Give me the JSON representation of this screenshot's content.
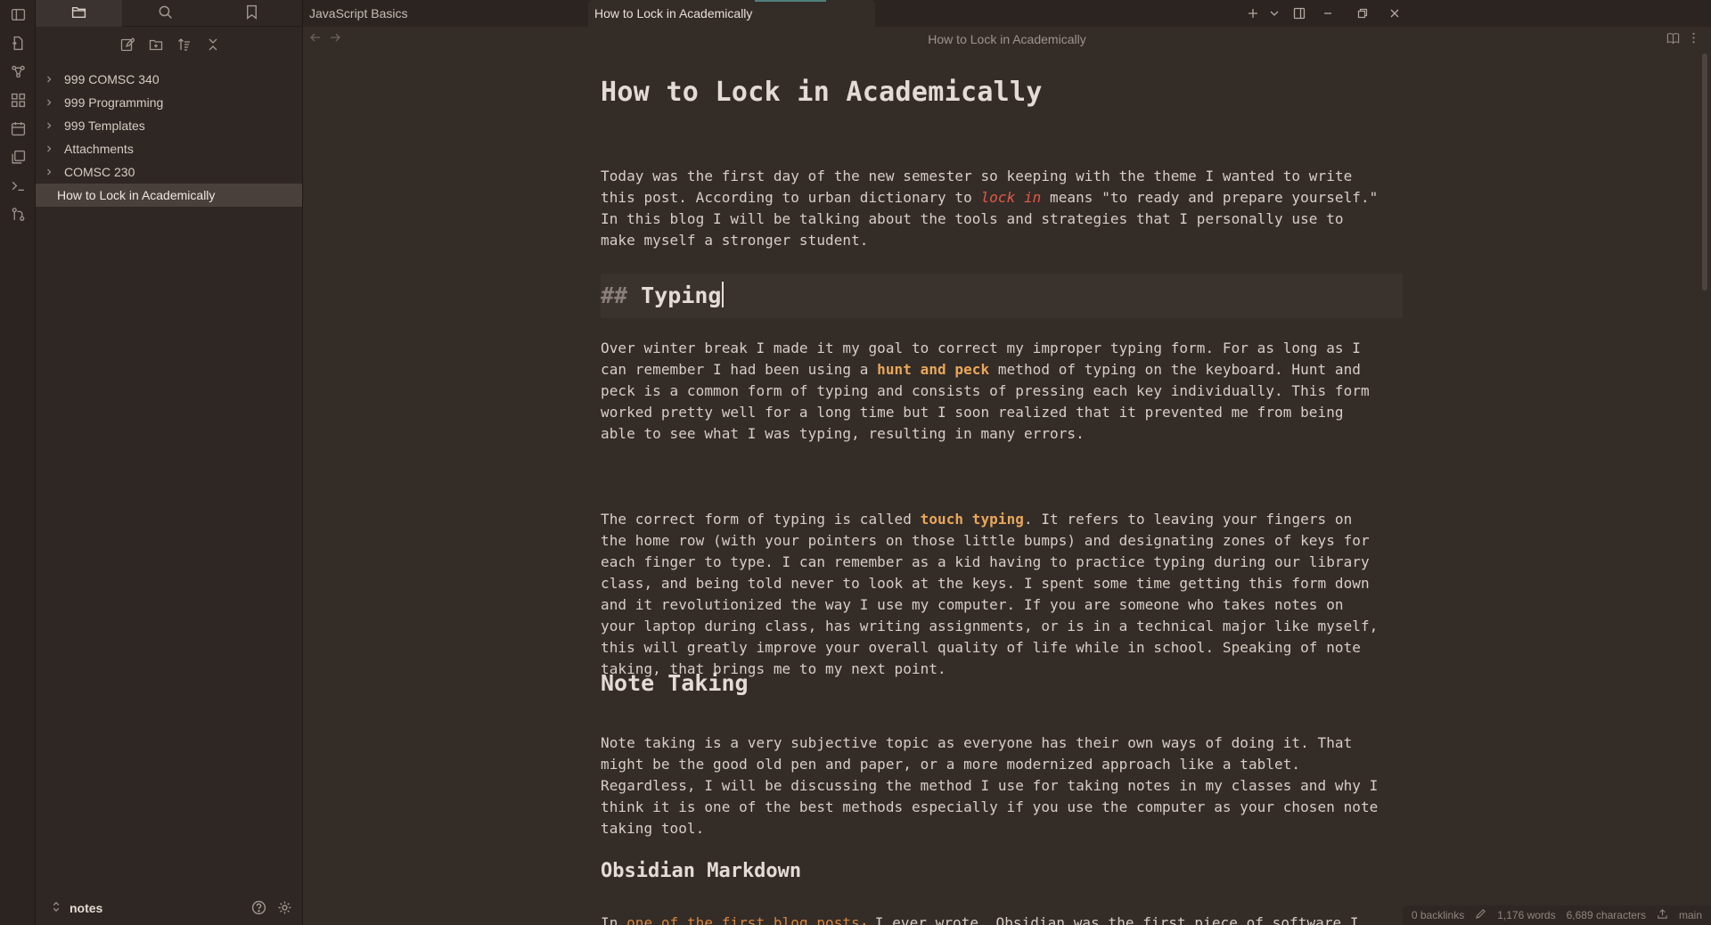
{
  "ribbon": {
    "icons": [
      "sidebar-toggle-icon",
      "open-quick-switcher-icon",
      "graph-view-icon",
      "canvas-icon",
      "daily-note-icon",
      "templates-icon",
      "terminal-icon",
      "git-icon"
    ]
  },
  "sidebar": {
    "tabs": [
      "files",
      "search",
      "bookmarks"
    ],
    "tree": [
      {
        "label": "999 COMSC 340",
        "type": "folder"
      },
      {
        "label": "999 Programming",
        "type": "folder"
      },
      {
        "label": "999 Templates",
        "type": "folder"
      },
      {
        "label": "Attachments",
        "type": "folder"
      },
      {
        "label": "COMSC 230",
        "type": "folder"
      },
      {
        "label": "How to Lock in Academically",
        "type": "file",
        "selected": true
      }
    ],
    "vault_name": "notes"
  },
  "tabs": [
    {
      "label": "JavaScript Basics",
      "active": false
    },
    {
      "label": "How to Lock in Academically",
      "active": true
    }
  ],
  "view": {
    "title": "How to Lock in Academically"
  },
  "document": {
    "title": "How to Lock in Academically",
    "p1_a": "Today was the first day of the new semester so keeping with the theme I wanted to write\nthis post. According to urban dictionary to ",
    "p1_em": "lock in",
    "p1_b": " means \"to ready and prepare yourself.\"\nIn this blog I will be talking about the tools and strategies that I personally use to\nmake myself a stronger student.",
    "h_typing_marker": "##",
    "h_typing": "Typing",
    "p2_a": "Over winter break I made it my goal to correct my improper typing form. For as long as I\ncan remember I had been using a ",
    "p2_bold": "hunt and peck",
    "p2_b": " method of typing on the keyboard. Hunt and\npeck is a common form of typing and consists of pressing each key individually. This form\nworked pretty well for a long time but I soon realized that it prevented me from being\nable to see what I was typing, resulting in many errors.",
    "p3_a": "The correct form of typing is called ",
    "p3_bold": "touch typing",
    "p3_b": ". It refers to leaving your fingers on\nthe home row (with your pointers on those little bumps) and designating zones of keys for\neach finger to type. I can remember as a kid having to practice typing during our library\nclass, and being told never to look at the keys. I spent some time getting this form down\nand it revolutionized the way I use my computer. If you are someone who takes notes on\nyour laptop during class, has writing assignments, or is in a technical major like myself,\nthis will greatly improve your overall quality of life while in school. Speaking of note\ntaking, that brings me to my next point.",
    "h_note": "Note Taking",
    "p4": "Note taking is a very subjective topic as everyone has their own ways of doing it. That\nmight be the good old pen and paper, or a more modernized approach like a tablet.\nRegardless, I will be discussing the method I use for taking notes in my classes and why I\nthink it is one of the best methods especially if you use the computer as your chosen note\ntaking tool.",
    "h_obsidian": "Obsidian Markdown",
    "p5_a": "In ",
    "p5_link": "one of the first blog posts",
    "p5_b": " I ever wrote, Obsidian was the first piece of software I"
  },
  "status": {
    "backlinks": "0 backlinks",
    "words": "1,176 words",
    "characters": "6,689 characters",
    "branch": "main"
  },
  "colors": {
    "accent": "#e9a75a",
    "italic_accent": "#e0594a",
    "link": "#d8873e"
  }
}
